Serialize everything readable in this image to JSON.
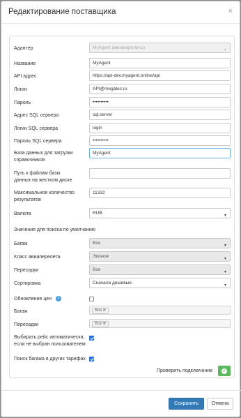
{
  "modal": {
    "title": "Редактирование поставщика",
    "close_label": "×"
  },
  "form": {
    "adapter": {
      "label": "Адаптер",
      "value": "MyAgent (авиаперелеты)"
    },
    "name": {
      "label": "Название",
      "value": "MyAgent"
    },
    "api_address": {
      "label": "API адрес",
      "value": "https://api-dev.myagent.online/api"
    },
    "login": {
      "label": "Логин",
      "value": "API@megatec.ru"
    },
    "password": {
      "label": "Пароль",
      "value": "••••••••••"
    },
    "sql_server": {
      "label": "Адрес SQL сервера",
      "value": "sql.server"
    },
    "sql_login": {
      "label": "Логин SQL сервера",
      "value": "login"
    },
    "sql_password": {
      "label": "Пароль SQL сервера",
      "value": "••••••••••"
    },
    "ref_db": {
      "label_line1": "База данных для загрузки",
      "label_line2": "справочников",
      "value": "MyAgent"
    },
    "files_path": {
      "label_line1": "Путь к файлам базы",
      "label_line2": "данных на жестком диске",
      "value": ""
    },
    "max_results": {
      "label_line1": "Максимальное количество",
      "label_line2": "результатов",
      "value": "11332"
    },
    "currency": {
      "label": "Валюта",
      "value": "RUB"
    }
  },
  "defaults": {
    "section_title": "Значения для поиска по умолчанию",
    "baggage": {
      "label": "Багаж",
      "value": "Все"
    },
    "flight_class": {
      "label": "Класс авиаперелета",
      "value": "Эконом"
    },
    "transfers": {
      "label": "Пересадки",
      "value": "Все"
    },
    "sort": {
      "label": "Сортировка",
      "value": "Сначала дешевые"
    }
  },
  "price_update": {
    "label": "Обновление цен",
    "info_icon": "info-icon",
    "checked": false,
    "baggage": {
      "label": "Багаж",
      "tag": "Все"
    },
    "transfers": {
      "label": "Пересадки",
      "tag": "Все"
    }
  },
  "auto_select": {
    "label_line1": "Выбирать рейс автоматически,",
    "label_line2": "если не выбран пользователем",
    "checked": true
  },
  "baggage_search": {
    "label": "Поиск багажа в других тарифах",
    "checked": true
  },
  "check_connection": {
    "label": "Проверить подключение",
    "icon": "check-circle-icon"
  },
  "footer": {
    "save_label": "Сохранить",
    "cancel_label": "Отмена"
  },
  "colors": {
    "primary": "#337ab7",
    "success": "#5cb85c",
    "checkbox": "#2a6edc",
    "info": "#4a9ee0"
  }
}
